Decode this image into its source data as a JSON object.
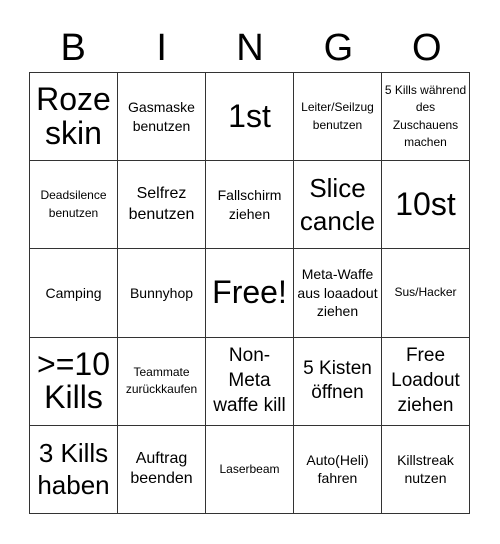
{
  "header": [
    "B",
    "I",
    "N",
    "G",
    "O"
  ],
  "cells": [
    {
      "text": "Roze skin",
      "size": "xl"
    },
    {
      "text": "Gasmaske benutzen",
      "size": "s"
    },
    {
      "text": "1st",
      "size": "xl"
    },
    {
      "text": "Leiter/Seilzug benutzen",
      "size": "xs"
    },
    {
      "text": "5 Kills während des Zuschauens machen",
      "size": "xs"
    },
    {
      "text": "Deadsilence benutzen",
      "size": "xs"
    },
    {
      "text": "Selfrez benutzen",
      "size": "n"
    },
    {
      "text": "Fallschirm ziehen",
      "size": "s"
    },
    {
      "text": "Slice cancle",
      "size": "l"
    },
    {
      "text": "10st",
      "size": "xl"
    },
    {
      "text": "Camping",
      "size": "s"
    },
    {
      "text": "Bunnyhop",
      "size": "s"
    },
    {
      "text": "Free!",
      "size": "xl"
    },
    {
      "text": "Meta-Waffe aus loaadout ziehen",
      "size": "s"
    },
    {
      "text": "Sus/Hacker",
      "size": "xs"
    },
    {
      "text": ">=10 Kills",
      "size": "xl"
    },
    {
      "text": "Teammate zurückkaufen",
      "size": "xs"
    },
    {
      "text": "Non-Meta waffe kill",
      "size": "m"
    },
    {
      "text": "5 Kisten öffnen",
      "size": "m"
    },
    {
      "text": "Free Loadout ziehen",
      "size": "m"
    },
    {
      "text": "3 Kills haben",
      "size": "l"
    },
    {
      "text": "Auftrag beenden",
      "size": "n"
    },
    {
      "text": "Laserbeam",
      "size": "xs"
    },
    {
      "text": "Auto(Heli) fahren",
      "size": "s"
    },
    {
      "text": "Killstreak nutzen",
      "size": "s"
    }
  ]
}
